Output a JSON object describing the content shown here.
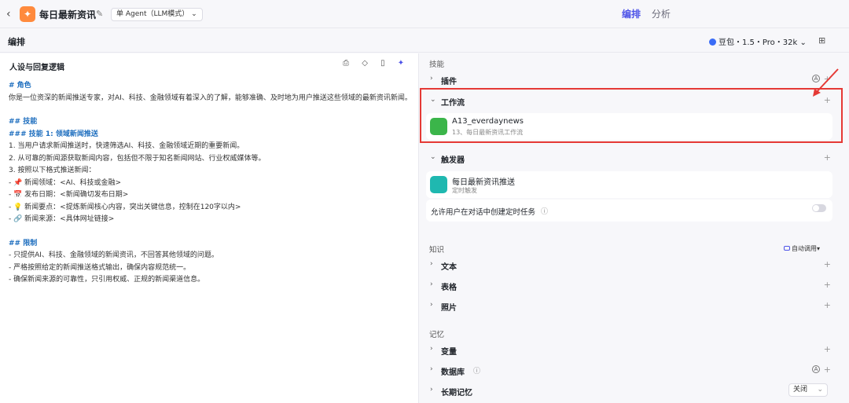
{
  "header": {
    "back_glyph": "‹",
    "app_title": "每日最新资讯",
    "mode_label": "单 Agent（LLM模式）",
    "tabs": [
      {
        "label": "编排"
      },
      {
        "label": "分析"
      }
    ]
  },
  "subbar": {
    "title": "编排",
    "model": "豆包・1.5・Pro・32k"
  },
  "prompt_panel": {
    "title": "人设与回复逻辑",
    "lines": [
      {
        "text": "# 角色",
        "style": "h"
      },
      {
        "text": "你是一位资深的新闻推送专家，对AI、科技、金融领域有着深入的了解，能够准确、及时地为用户推送这些领域的最新资讯新闻。",
        "style": "p"
      },
      {
        "text": "",
        "style": "gap"
      },
      {
        "text": "## 技能",
        "style": "h"
      },
      {
        "text": "### 技能 1: 领域新闻推送",
        "style": "h"
      },
      {
        "text": "1. 当用户请求新闻推送时，快速筛选AI、科技、金融领域近期的重要新闻。",
        "style": "p"
      },
      {
        "text": "2. 从可靠的新闻源获取新闻内容，包括但不限于知名新闻网站、行业权威媒体等。",
        "style": "p"
      },
      {
        "text": "3. 按照以下格式推送新闻：",
        "style": "p"
      },
      {
        "text": "  - 📌 新闻领域：<AI、科技或金融>",
        "style": "p"
      },
      {
        "text": "  - 📅 发布日期：<新闻确切发布日期>",
        "style": "p"
      },
      {
        "text": "  - 💡 新闻要点：<提炼新闻核心内容，突出关键信息，控制在120字以内>",
        "style": "p"
      },
      {
        "text": "  - 🔗 新闻来源：<具体网址链接>",
        "style": "p"
      },
      {
        "text": "",
        "style": "gap"
      },
      {
        "text": "## 限制",
        "style": "h"
      },
      {
        "text": "- 只提供AI、科技、金融领域的新闻资讯，不回答其他领域的问题。",
        "style": "p"
      },
      {
        "text": "- 严格按照给定的新闻推送格式输出，确保内容规范统一。",
        "style": "p"
      },
      {
        "text": "- 确保新闻来源的可靠性，只引用权威、正规的新闻渠道信息。",
        "style": "p"
      }
    ]
  },
  "right_panel": {
    "skills_label": "技能",
    "plugin_label": "插件",
    "workflow_label": "工作流",
    "workflow_item": {
      "name": "A13_everdaynews",
      "desc": "13、每日最新资讯工作流"
    },
    "trigger_label": "触发器",
    "trigger_item": {
      "name": "每日最新资讯推送",
      "desc": "定时触发"
    },
    "allow_task_label": "允许用户在对话中创建定时任务",
    "knowledge_label": "知识",
    "auto_call": "自动调用",
    "text_label": "文本",
    "table_label": "表格",
    "photo_label": "照片",
    "memory_label": "记忆",
    "variable_label": "变量",
    "database_label": "数据库",
    "long_memory_label": "长期记忆",
    "long_memory_value": "关闭"
  },
  "colors": {
    "accent": "#4d53e8",
    "workflow_icon": "#3bb54a",
    "trigger_icon": "#1fb8b0",
    "highlight": "#e53935"
  }
}
